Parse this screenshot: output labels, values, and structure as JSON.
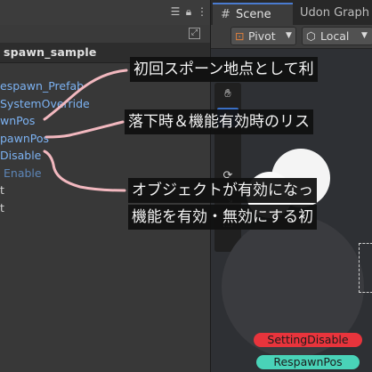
{
  "hierarchy": {
    "topbar_icons": [
      "menu-icon",
      "lock-icon",
      "more-icon"
    ],
    "toolbar_icon": "expand-icon",
    "scene_name": "spawn_sample",
    "rows": [
      {
        "text": "espawn_Prefab",
        "color": "blue"
      },
      {
        "text": "SystemOverride",
        "color": "blue"
      },
      {
        "text": "wnPos",
        "color": "blue"
      },
      {
        "text": "pawnPos",
        "color": "blue"
      },
      {
        "text": "Disable",
        "color": "blue"
      },
      {
        "text": "Enable",
        "color": "dimblue"
      },
      {
        "text": "t",
        "color": "white"
      },
      {
        "text": "t",
        "color": "white"
      }
    ]
  },
  "scene_panel": {
    "tab_scene_label": "Scene",
    "tab_udon_label": "Udon Graph",
    "pivot_label": "Pivot",
    "local_label": "Local",
    "tools": [
      "hand-tool",
      "move-tool",
      "rotate-tool",
      "scale-tool",
      "rect-tool"
    ],
    "world_labels": {
      "setting_disable": "SettingDisable",
      "respawn_pos": "RespawnPos"
    },
    "colors": {
      "setting_disable_bg": "#e8343c",
      "respawn_pos_bg": "#49d3b8",
      "accent": "#4a7bd0"
    }
  },
  "annotations": {
    "first_spawn": "初回スポーン地点として利",
    "fall_respawn": "落下時＆機能有効時のリス",
    "object_enabled_line1": "オブジェクトが有効になっ",
    "object_enabled_line2": "機能を有効・無効にする初"
  }
}
